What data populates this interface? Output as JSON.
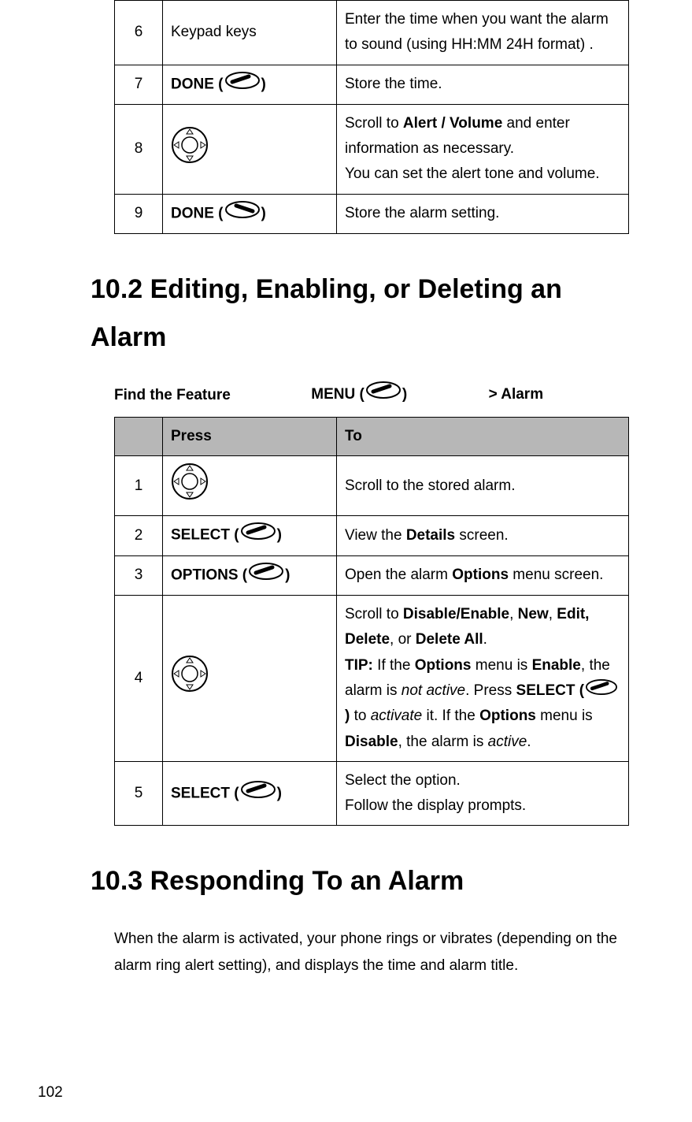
{
  "table1": {
    "rows": [
      {
        "num": "6",
        "press": "Keypad keys",
        "to": "Enter the time when you want the alarm to sound (using HH:MM 24H format) ."
      },
      {
        "num": "7",
        "press_label": "DONE",
        "to": "Store the time."
      },
      {
        "num": "8",
        "to_pre": "Scroll to ",
        "to_bold1": "Alert / Volume",
        "to_mid": " and enter information as necessary.",
        "to_line2": "You can set the alert tone and volume."
      },
      {
        "num": "9",
        "press_label": "DONE",
        "to": "Store the alarm setting."
      }
    ]
  },
  "heading102": "10.2   Editing, Enabling, or Deleting an Alarm",
  "find_feature": "Find the Feature",
  "menu_label": "MENU",
  "breadcrumb": "> Alarm",
  "table2": {
    "header_col2": "Press",
    "header_col3": "To",
    "rows": [
      {
        "num": "1",
        "to": "Scroll to the stored alarm."
      },
      {
        "num": "2",
        "press_label": "SELECT",
        "to_pre": "View the ",
        "to_bold": "Details",
        "to_post": " screen."
      },
      {
        "num": "3",
        "press_label": "OPTIONS",
        "to_pre": "Open the alarm ",
        "to_bold": "Options",
        "to_post": " menu screen."
      },
      {
        "num": "4",
        "l1_pre": "Scroll to ",
        "l1_b1": "Disable/Enable",
        "l1_c1": ", ",
        "l1_b2": "New",
        "l1_c2": ", ",
        "l1_b3": "Edit, Delete",
        "l1_c3": ", or ",
        "l1_b4": "Delete All",
        "l1_c4": ".",
        "tip_label": "TIP:",
        "tip_t1": " If the ",
        "tip_b1": "Options",
        "tip_t2": " menu is ",
        "tip_b2": "Enable",
        "tip_t3": ", the alarm is ",
        "tip_i1": "not active",
        "tip_t4": ". Press ",
        "tip_b3": "SELECT (",
        "tip_b4": ")",
        "tip_t5": " to ",
        "tip_i2": "activate",
        "tip_t6": " it. If the ",
        "tip_b5": "Options",
        "tip_t7": " menu is ",
        "tip_b6": "Disable",
        "tip_t8": ", the alarm is ",
        "tip_i3": "active",
        "tip_t9": "."
      },
      {
        "num": "5",
        "press_label": "SELECT",
        "to_l1": "Select the option.",
        "to_l2": "Follow the display prompts."
      }
    ]
  },
  "heading103": "10.3 Responding To an Alarm",
  "para103": "When the alarm is activated, your phone rings or vibrates (depending on the alarm ring alert setting), and displays the time and alarm title.",
  "page_number": "102",
  "open_paren": " (",
  "close_paren": ")"
}
